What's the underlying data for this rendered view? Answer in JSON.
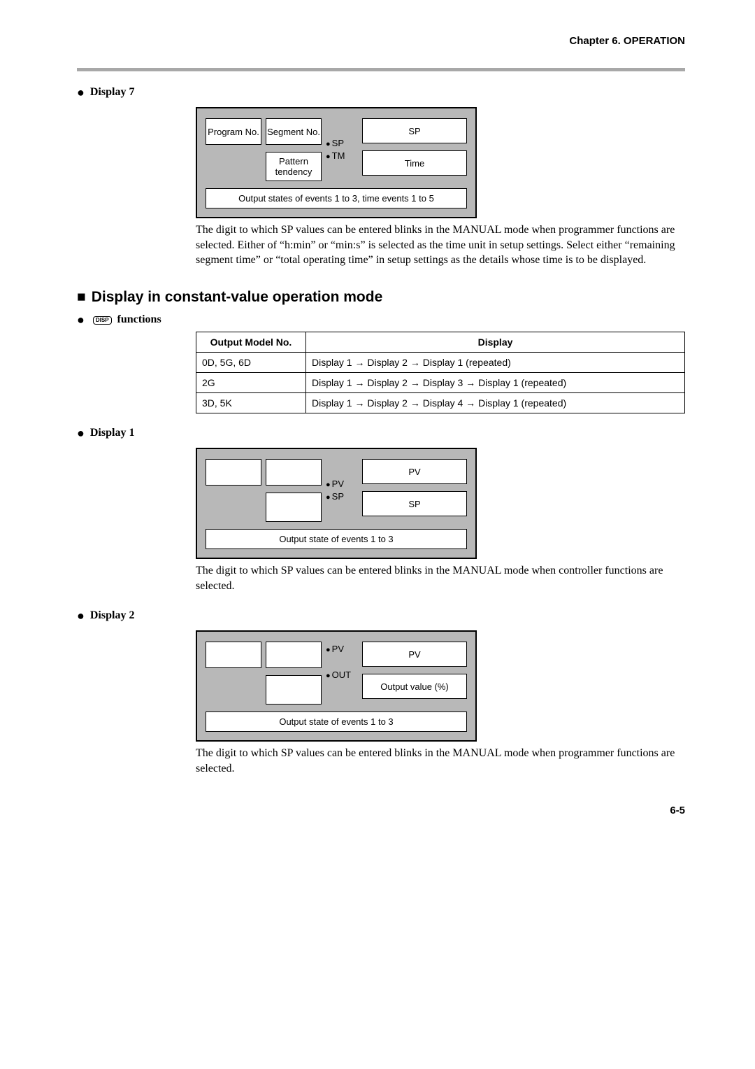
{
  "chapter": "Chapter 6. OPERATION",
  "display7": {
    "heading": "Display 7",
    "programNo": "Program No.",
    "segmentNo": "Segment No.",
    "sp_ind": "SP",
    "tm_ind": "TM",
    "sp_box": "SP",
    "pattern": "Pattern tendency",
    "time_box": "Time",
    "bottom": "Output states of events 1 to 3, time events 1 to 5",
    "para": "The digit to which SP values can be entered blinks in the MANUAL mode when programmer functions are selected. Either of “h:min” or “min:s” is selected as the time unit in setup settings. Select either “remaining segment time” or “total operating time” in setup settings as the details whose time is to be displayed."
  },
  "section2": {
    "heading": "Display in constant-value operation mode",
    "funcHeading": "functions",
    "keyLabel": "DISP",
    "table": {
      "h1": "Output Model No.",
      "h2": "Display",
      "rows": [
        {
          "m": "0D, 5G, 6D",
          "d": "Display 1 → Display 2 → Display 1 (repeated)"
        },
        {
          "m": "2G",
          "d": "Display 1 → Display 2 → Display 3 → Display 1 (repeated)"
        },
        {
          "m": "3D, 5K",
          "d": "Display 1 → Display 2 → Display 4 → Display 1 (repeated)"
        }
      ]
    }
  },
  "display1": {
    "heading": "Display 1",
    "pv_ind": "PV",
    "sp_ind": "SP",
    "pv_box": "PV",
    "sp_box": "SP",
    "bottom": "Output state of events 1 to 3",
    "para": "The digit to which SP values can be entered blinks in the MANUAL mode when controller functions are selected."
  },
  "display2": {
    "heading": "Display 2",
    "pv_ind": "PV",
    "out_ind": "OUT",
    "pv_box": "PV",
    "out_box": "Output value (%)",
    "bottom": "Output state of events 1 to 3",
    "para": "The digit to which SP values can be entered blinks in the MANUAL mode when programmer functions are selected."
  },
  "pageNum": "6-5"
}
